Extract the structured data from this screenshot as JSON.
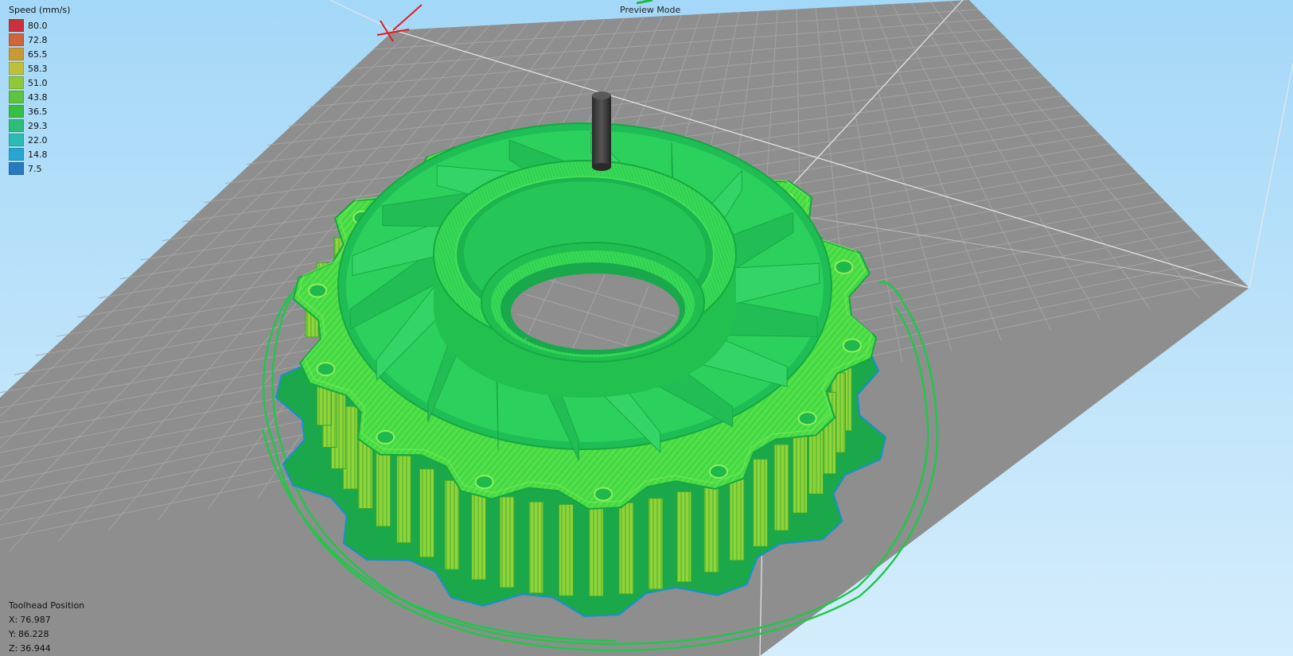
{
  "view": {
    "mode_label": "Preview Mode"
  },
  "legend": {
    "title": "Speed (mm/s)",
    "entries": [
      {
        "value": "80.0",
        "color": "#c8323a"
      },
      {
        "value": "72.8",
        "color": "#d0643a"
      },
      {
        "value": "65.5",
        "color": "#cc9a34"
      },
      {
        "value": "58.3",
        "color": "#bcc03a"
      },
      {
        "value": "51.0",
        "color": "#90c83c"
      },
      {
        "value": "43.8",
        "color": "#5cc43e"
      },
      {
        "value": "36.5",
        "color": "#38bf42"
      },
      {
        "value": "29.3",
        "color": "#2ebd78"
      },
      {
        "value": "22.0",
        "color": "#2cbbb4"
      },
      {
        "value": "14.8",
        "color": "#28a6d0"
      },
      {
        "value": "7.5",
        "color": "#2878c2"
      }
    ]
  },
  "toolhead": {
    "title": "Toolhead Position",
    "x_label": "X:",
    "x_value": "76.987",
    "y_label": "Y:",
    "y_value": "86.228",
    "z_label": "Z:",
    "z_value": "36.944"
  },
  "colors": {
    "background_top": "#a8daf8",
    "background_bottom": "#d6eefc",
    "bed": "#8e8e8e",
    "bed_grid": "#a9a9a9",
    "print_primary": "#2fd64a",
    "print_light": "#72e844",
    "print_dark": "#1ea83c",
    "print_outline": "#13a83a",
    "travel_line": "#1dc84a",
    "nozzle": "#3a3a3a",
    "axis_x": "#e01c1c"
  },
  "icons": {
    "origin_marker": "axis-origin-icon"
  }
}
